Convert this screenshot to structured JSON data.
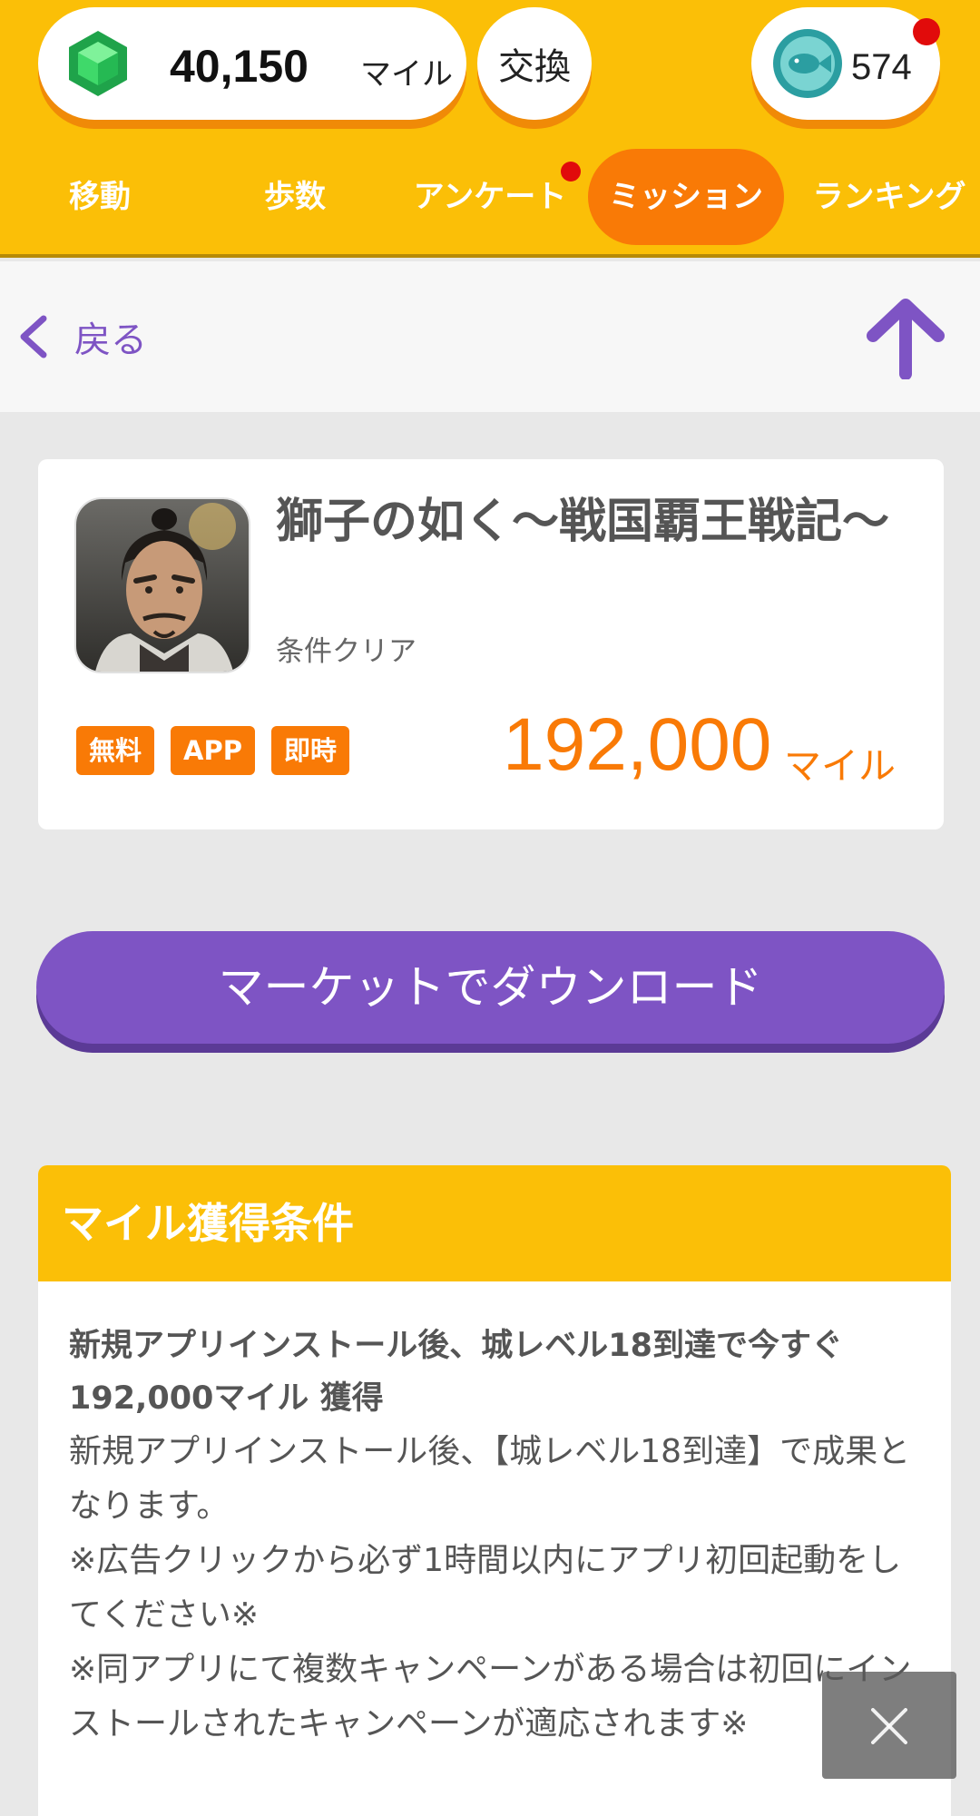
{
  "header": {
    "miles_value": "40,150",
    "miles_unit": "マイル",
    "exchange_label": "交換",
    "fish_count": "574"
  },
  "tabs": [
    {
      "label": "移動"
    },
    {
      "label": "歩数"
    },
    {
      "label": "アンケート"
    },
    {
      "label": "ミッション",
      "active": true
    },
    {
      "label": "ランキング"
    }
  ],
  "nav": {
    "back_label": "戻る"
  },
  "card": {
    "title": "獅子の如く～戦国覇王戦記～",
    "subtitle": "条件クリア",
    "badges": [
      "無料",
      "APP",
      "即時"
    ],
    "reward_value": "192,000",
    "reward_unit": "マイル"
  },
  "download_button": "マーケットでダウンロード",
  "conditions": {
    "heading": "マイル獲得条件",
    "bold_line": "新規アプリインストール後、城レベル18到達で今すぐ 192,000マイル 獲得",
    "text": "新規アプリインストール後、【城レベル18到達】で成果となります。\n※広告クリックから必ず1時間以内にアプリ初回起動をしてください※\n※同アプリにて複数キャンペーンがある場合は初回にインストールされたキャンペーンが適応されます※"
  },
  "colors": {
    "header_yellow": "#fbbf07",
    "accent_orange": "#f97a06",
    "accent_purple": "#7e54c4"
  },
  "icons": {
    "miles": "green-gem-icon",
    "fish": "fish-coin-icon",
    "back": "chevron-left-icon",
    "top": "arrow-up-icon",
    "close": "close-icon"
  }
}
